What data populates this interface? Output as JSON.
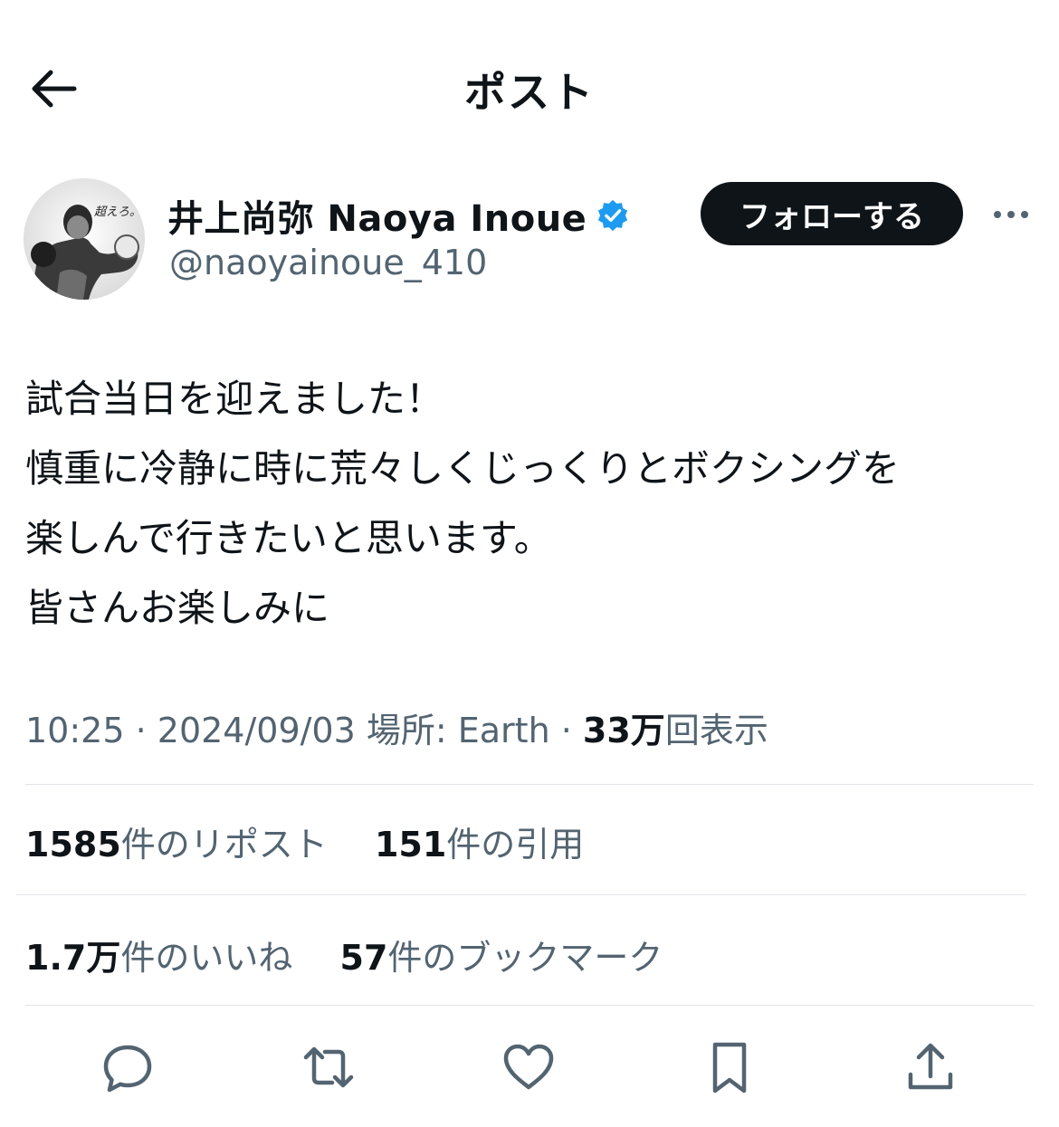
{
  "header": {
    "title": "ポスト",
    "back_icon": "arrow-left-icon"
  },
  "author": {
    "display_name": "井上尚弥  Naoya Inoue",
    "handle": "@naoyainoue_410",
    "verified_icon": "verified-badge-icon",
    "verified_color": "#1d9bf0",
    "avatar_caption": "超えろ。"
  },
  "follow_button": {
    "label": "フォローする"
  },
  "more_icon": "more-horizontal-icon",
  "post": {
    "lines": [
      "試合当日を迎えました！",
      "慎重に冷静に時に荒々しくじっくりとボクシングを",
      "楽しんで行きたいと思います。",
      "皆さんお楽しみに"
    ]
  },
  "meta": {
    "time": "10:25",
    "sep1": " · ",
    "date": "2024/09/03",
    "location": " 場所: Earth",
    "sep2": " · ",
    "views_num": "33万",
    "views_label": "回表示"
  },
  "stats": {
    "reposts_num": "1585",
    "reposts_label": "件のリポスト",
    "quotes_num": "151",
    "quotes_label": "件の引用",
    "likes_num": "1.7万",
    "likes_label": "件のいいね",
    "bookmarks_num": "57",
    "bookmarks_label": "件のブックマーク"
  },
  "actions": [
    "reply-icon",
    "repost-icon",
    "like-icon",
    "bookmark-icon",
    "share-icon"
  ],
  "colors": {
    "text": "#0f1419",
    "secondary": "#536471",
    "divider": "#e1e4e8",
    "follow_bg": "#0f1419"
  }
}
